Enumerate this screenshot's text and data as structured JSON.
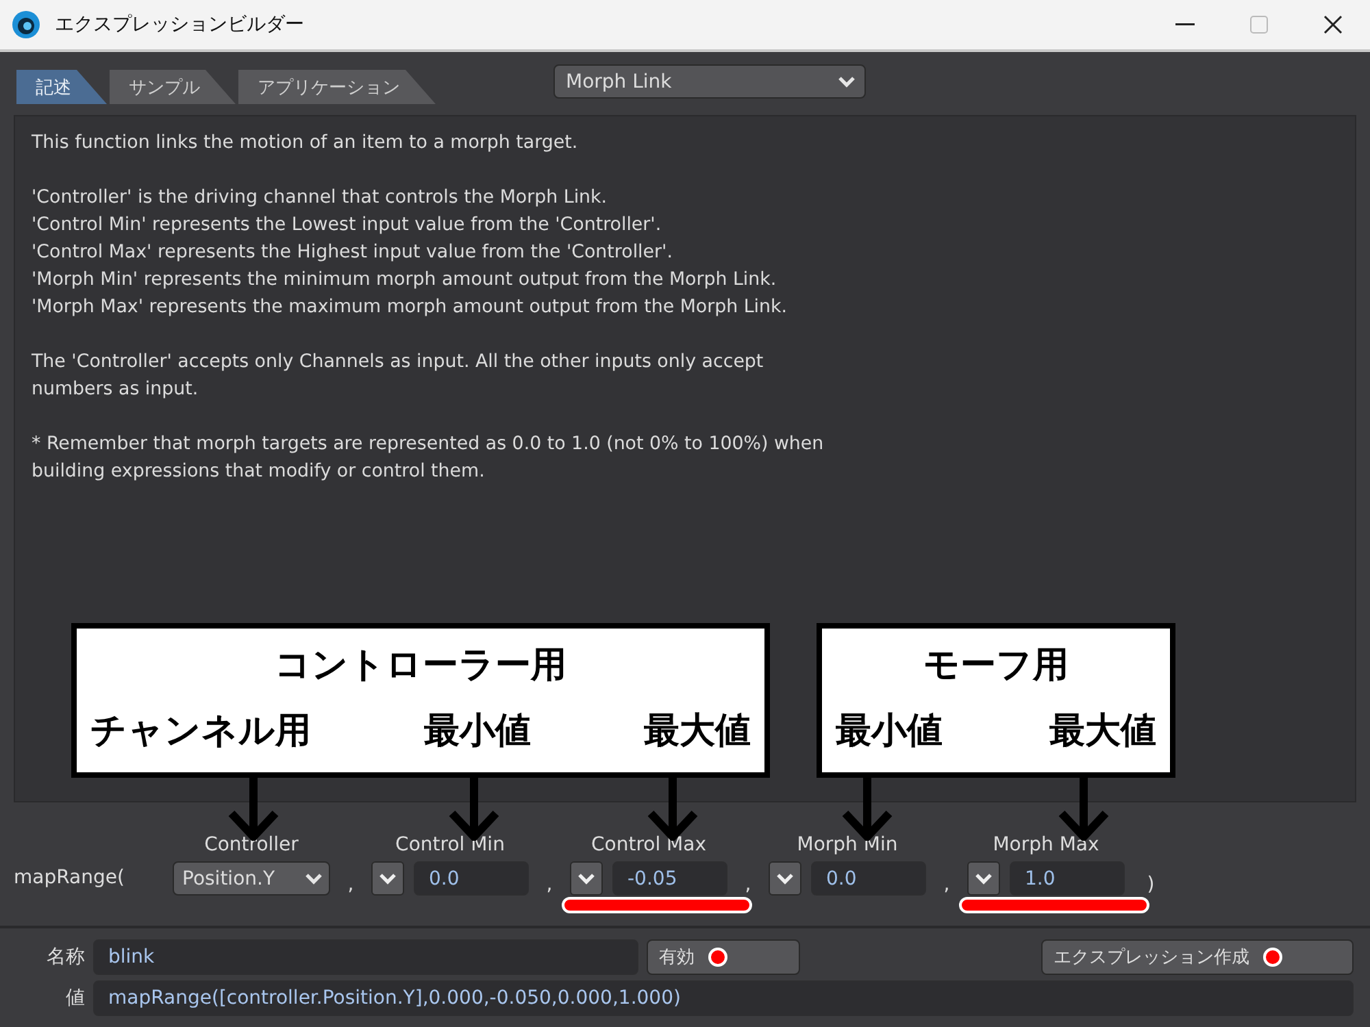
{
  "window": {
    "title": "エクスプレッションビルダー"
  },
  "tabs": [
    {
      "label": "記述",
      "selected": true
    },
    {
      "label": "サンプル",
      "selected": false
    },
    {
      "label": "アプリケーション",
      "selected": false
    }
  ],
  "function_select": {
    "value": "Morph Link"
  },
  "description": [
    [
      "This function links the motion of an item to a morph target."
    ],
    [
      "'Controller' is the driving channel that controls the Morph Link.",
      "'Control Min' represents the Lowest input value from the 'Controller'.",
      "'Control Max' represents the Highest input value from the 'Controller'.",
      "'Morph Min' represents the minimum morph amount output from the Morph Link.",
      "'Morph Max' represents the maximum morph amount output from the Morph Link."
    ],
    [
      "The 'Controller' accepts only Channels as input. All the other inputs only accept",
      "numbers as input."
    ],
    [
      "* Remember that morph targets are represented as 0.0 to 1.0 (not 0% to 100%) when",
      "building expressions that modify or control them."
    ]
  ],
  "annotations": [
    {
      "title": "コントローラー用",
      "labels": [
        "チャンネル用",
        "最小値",
        "最大値"
      ]
    },
    {
      "title": "モーフ用",
      "labels": [
        "最小値",
        "最大値"
      ]
    }
  ],
  "expression": {
    "function": "mapRange(",
    "separator": ",",
    "close": ")",
    "params": [
      {
        "kind": "select",
        "label": "Controller",
        "value": "Position.Y",
        "underlined": false
      },
      {
        "kind": "number",
        "label": "Control Min",
        "value": "0.0",
        "underlined": false
      },
      {
        "kind": "number",
        "label": "Control Max",
        "value": "-0.05",
        "underlined": true
      },
      {
        "kind": "number",
        "label": "Morph Min",
        "value": "0.0",
        "underlined": false
      },
      {
        "kind": "number",
        "label": "Morph Max",
        "value": "1.0",
        "underlined": true
      }
    ]
  },
  "name_row": {
    "label": "名称",
    "value": "blink"
  },
  "buttons": [
    {
      "label": "有効",
      "marked": true
    },
    {
      "label": "エクスプレッション作成",
      "marked": true
    }
  ],
  "value_row": {
    "label": "値",
    "value": "mapRange([controller.Position.Y],0.000,-0.050,0.000,1.000)"
  }
}
